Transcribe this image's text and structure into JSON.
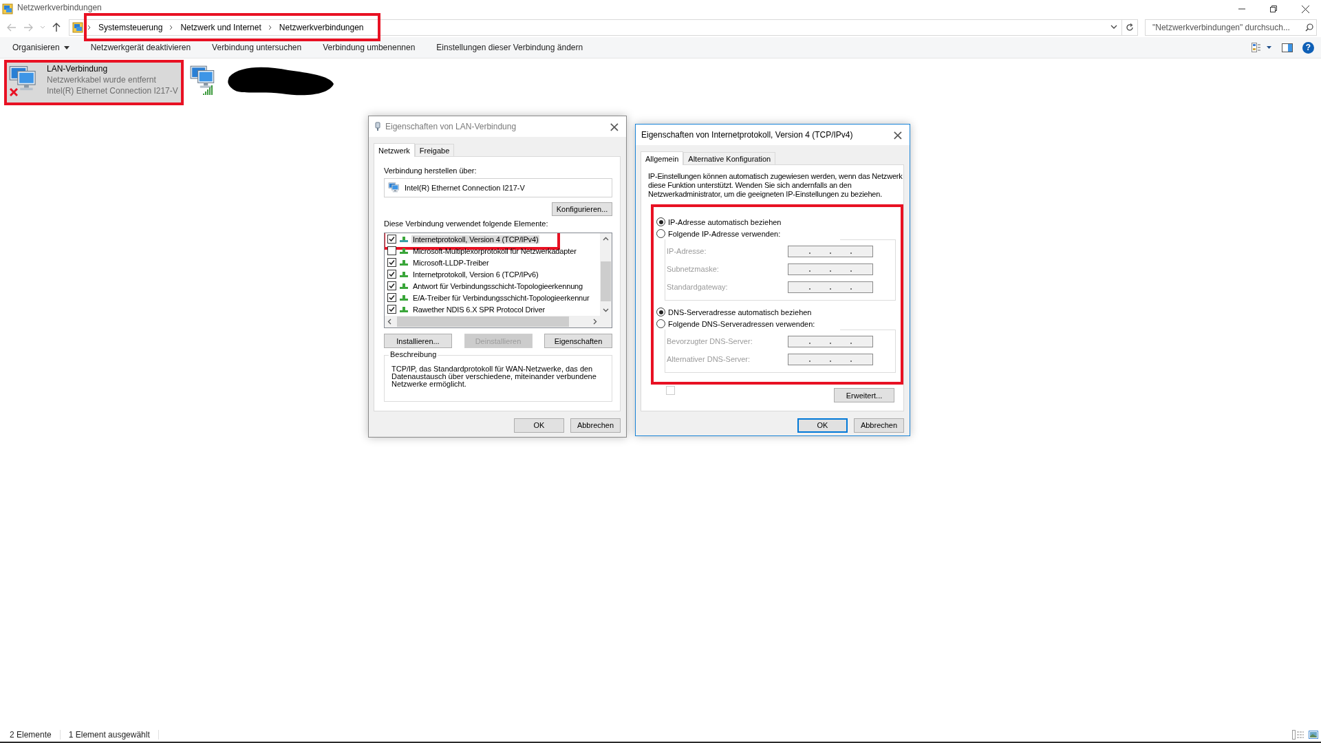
{
  "window": {
    "title": "Netzwerkverbindungen"
  },
  "address_bar": {
    "breadcrumbs": [
      "Systemsteuerung",
      "Netzwerk und Internet",
      "Netzwerkverbindungen"
    ],
    "highlighted": true
  },
  "search": {
    "placeholder": "\"Netzwerkverbindungen\" durchsuch..."
  },
  "toolbar": {
    "items": [
      {
        "label": "Organisieren",
        "dropdown": true
      },
      {
        "label": "Netzwerkgerät deaktivieren",
        "dropdown": false
      },
      {
        "label": "Verbindung untersuchen",
        "dropdown": false
      },
      {
        "label": "Verbindung umbenennen",
        "dropdown": false
      },
      {
        "label": "Einstellungen dieser Verbindung ändern",
        "dropdown": false
      }
    ],
    "help": "?"
  },
  "connections": [
    {
      "kind": "ethernet",
      "name": "LAN-Verbindung",
      "status": "Netzwerkkabel wurde entfernt",
      "device": "Intel(R) Ethernet Connection I217-V",
      "selected": true,
      "disconnected": true,
      "highlighted": true
    },
    {
      "kind": "wireless",
      "selected": false,
      "redacted": true
    }
  ],
  "lan_dialog": {
    "title": "Eigenschaften von LAN-Verbindung",
    "close": "×",
    "tabs": [
      {
        "label": "Netzwerk",
        "selected": true
      },
      {
        "label": "Freigabe",
        "selected": false
      }
    ],
    "connect_label": "Verbindung herstellen über:",
    "adapter": "Intel(R) Ethernet Connection I217-V",
    "configure_button": "Konfigurieren...",
    "components_label": "Diese Verbindung verwendet folgende Elemente:",
    "components": [
      {
        "label": "Internetprotokoll, Version 4 (TCP/IPv4)",
        "checked": true,
        "selected": true,
        "highlighted": true
      },
      {
        "label": "Microsoft-Multiplexorprotokoll für Netzwerkadapter",
        "checked": false,
        "selected": false,
        "highlighted": false
      },
      {
        "label": "Microsoft-LLDP-Treiber",
        "checked": true,
        "selected": false,
        "highlighted": false
      },
      {
        "label": "Internetprotokoll, Version 6 (TCP/IPv6)",
        "checked": true,
        "selected": false,
        "highlighted": false
      },
      {
        "label": "Antwort für Verbindungsschicht-Topologieerkennung",
        "checked": true,
        "selected": false,
        "highlighted": false
      },
      {
        "label": "E/A-Treiber für Verbindungsschicht-Topologieerkennur",
        "checked": true,
        "selected": false,
        "highlighted": false
      },
      {
        "label": "Rawether NDIS 6.X SPR Protocol Driver",
        "checked": true,
        "selected": false,
        "highlighted": false
      }
    ],
    "buttons": [
      {
        "label": "Installieren...",
        "disabled": false
      },
      {
        "label": "Deinstallieren",
        "disabled": true
      },
      {
        "label": "Eigenschaften",
        "disabled": false
      }
    ],
    "description": {
      "legend": "Beschreibung",
      "text": "TCP/IP, das Standardprotokoll für WAN-Netzwerke, das den Datenaustausch über verschiedene, miteinander verbundene Netzwerke ermöglicht."
    },
    "footer_buttons": [
      {
        "label": "OK",
        "default": false
      },
      {
        "label": "Abbrechen",
        "default": false
      }
    ]
  },
  "ipv4_dialog": {
    "title": "Eigenschaften von Internetprotokoll, Version 4 (TCP/IPv4)",
    "close": "×",
    "tabs": [
      {
        "label": "Allgemein",
        "selected": true
      },
      {
        "label": "Alternative Konfiguration",
        "selected": false
      }
    ],
    "intro": "IP-Einstellungen können automatisch zugewiesen werden, wenn das Netzwerk diese Funktion unterstützt. Wenden Sie sich andernfalls an den Netzwerkadministrator, um die geeigneten IP-Einstellungen zu beziehen.",
    "highlighted": true,
    "ip_options": [
      {
        "label": "IP-Adresse automatisch beziehen",
        "selected": true
      },
      {
        "label": "Folgende IP-Adresse verwenden:",
        "selected": false
      }
    ],
    "ip_fields": [
      {
        "label": "IP-Adresse:",
        "disabled": true
      },
      {
        "label": "Subnetzmaske:",
        "disabled": true
      },
      {
        "label": "Standardgateway:",
        "disabled": true
      }
    ],
    "dns_options": [
      {
        "label": "DNS-Serveradresse automatisch beziehen",
        "selected": true
      },
      {
        "label": "Folgende DNS-Serveradressen verwenden:",
        "selected": false
      }
    ],
    "dns_fields": [
      {
        "label": "Bevorzugter DNS-Server:",
        "disabled": true
      },
      {
        "label": "Alternativer DNS-Server:",
        "disabled": true
      }
    ],
    "validate_checkbox": {
      "checked": false,
      "disabled": true
    },
    "advanced_button": "Erweitert...",
    "footer_buttons": [
      {
        "label": "OK",
        "default": true
      },
      {
        "label": "Abbrechen",
        "default": false
      }
    ]
  },
  "status_bar": {
    "count": "2 Elemente",
    "selection": "1 Element ausgewählt"
  }
}
